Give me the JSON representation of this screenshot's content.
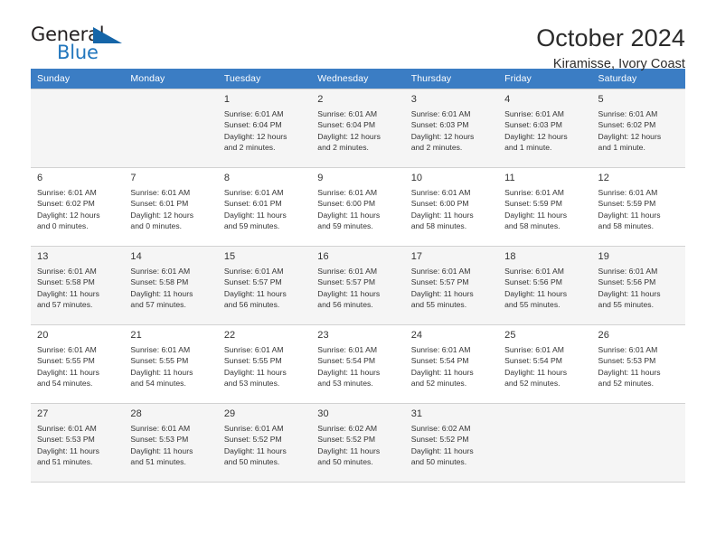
{
  "brand": {
    "word_one": "General",
    "word_two": "Blue",
    "triangle_icon": "triangle-icon",
    "accent_color": "#2176bd",
    "dark_color": "#231f20"
  },
  "header": {
    "title": "October 2024",
    "subtitle": "Kiramisse, Ivory Coast"
  },
  "calendar": {
    "header_bg": "#3b7dc4",
    "weekday_headers": [
      "Sunday",
      "Monday",
      "Tuesday",
      "Wednesday",
      "Thursday",
      "Friday",
      "Saturday"
    ],
    "weeks": [
      [
        {
          "day": "",
          "sunrise": "",
          "sunset": "",
          "daylight_line1": "",
          "daylight_line2": "",
          "empty": true
        },
        {
          "day": "",
          "sunrise": "",
          "sunset": "",
          "daylight_line1": "",
          "daylight_line2": "",
          "empty": true
        },
        {
          "day": "1",
          "sunrise": "Sunrise: 6:01 AM",
          "sunset": "Sunset: 6:04 PM",
          "daylight_line1": "Daylight: 12 hours",
          "daylight_line2": "and 2 minutes.",
          "empty": false
        },
        {
          "day": "2",
          "sunrise": "Sunrise: 6:01 AM",
          "sunset": "Sunset: 6:04 PM",
          "daylight_line1": "Daylight: 12 hours",
          "daylight_line2": "and 2 minutes.",
          "empty": false
        },
        {
          "day": "3",
          "sunrise": "Sunrise: 6:01 AM",
          "sunset": "Sunset: 6:03 PM",
          "daylight_line1": "Daylight: 12 hours",
          "daylight_line2": "and 2 minutes.",
          "empty": false
        },
        {
          "day": "4",
          "sunrise": "Sunrise: 6:01 AM",
          "sunset": "Sunset: 6:03 PM",
          "daylight_line1": "Daylight: 12 hours",
          "daylight_line2": "and 1 minute.",
          "empty": false
        },
        {
          "day": "5",
          "sunrise": "Sunrise: 6:01 AM",
          "sunset": "Sunset: 6:02 PM",
          "daylight_line1": "Daylight: 12 hours",
          "daylight_line2": "and 1 minute.",
          "empty": false
        }
      ],
      [
        {
          "day": "6",
          "sunrise": "Sunrise: 6:01 AM",
          "sunset": "Sunset: 6:02 PM",
          "daylight_line1": "Daylight: 12 hours",
          "daylight_line2": "and 0 minutes.",
          "empty": false
        },
        {
          "day": "7",
          "sunrise": "Sunrise: 6:01 AM",
          "sunset": "Sunset: 6:01 PM",
          "daylight_line1": "Daylight: 12 hours",
          "daylight_line2": "and 0 minutes.",
          "empty": false
        },
        {
          "day": "8",
          "sunrise": "Sunrise: 6:01 AM",
          "sunset": "Sunset: 6:01 PM",
          "daylight_line1": "Daylight: 11 hours",
          "daylight_line2": "and 59 minutes.",
          "empty": false
        },
        {
          "day": "9",
          "sunrise": "Sunrise: 6:01 AM",
          "sunset": "Sunset: 6:00 PM",
          "daylight_line1": "Daylight: 11 hours",
          "daylight_line2": "and 59 minutes.",
          "empty": false
        },
        {
          "day": "10",
          "sunrise": "Sunrise: 6:01 AM",
          "sunset": "Sunset: 6:00 PM",
          "daylight_line1": "Daylight: 11 hours",
          "daylight_line2": "and 58 minutes.",
          "empty": false
        },
        {
          "day": "11",
          "sunrise": "Sunrise: 6:01 AM",
          "sunset": "Sunset: 5:59 PM",
          "daylight_line1": "Daylight: 11 hours",
          "daylight_line2": "and 58 minutes.",
          "empty": false
        },
        {
          "day": "12",
          "sunrise": "Sunrise: 6:01 AM",
          "sunset": "Sunset: 5:59 PM",
          "daylight_line1": "Daylight: 11 hours",
          "daylight_line2": "and 58 minutes.",
          "empty": false
        }
      ],
      [
        {
          "day": "13",
          "sunrise": "Sunrise: 6:01 AM",
          "sunset": "Sunset: 5:58 PM",
          "daylight_line1": "Daylight: 11 hours",
          "daylight_line2": "and 57 minutes.",
          "empty": false
        },
        {
          "day": "14",
          "sunrise": "Sunrise: 6:01 AM",
          "sunset": "Sunset: 5:58 PM",
          "daylight_line1": "Daylight: 11 hours",
          "daylight_line2": "and 57 minutes.",
          "empty": false
        },
        {
          "day": "15",
          "sunrise": "Sunrise: 6:01 AM",
          "sunset": "Sunset: 5:57 PM",
          "daylight_line1": "Daylight: 11 hours",
          "daylight_line2": "and 56 minutes.",
          "empty": false
        },
        {
          "day": "16",
          "sunrise": "Sunrise: 6:01 AM",
          "sunset": "Sunset: 5:57 PM",
          "daylight_line1": "Daylight: 11 hours",
          "daylight_line2": "and 56 minutes.",
          "empty": false
        },
        {
          "day": "17",
          "sunrise": "Sunrise: 6:01 AM",
          "sunset": "Sunset: 5:57 PM",
          "daylight_line1": "Daylight: 11 hours",
          "daylight_line2": "and 55 minutes.",
          "empty": false
        },
        {
          "day": "18",
          "sunrise": "Sunrise: 6:01 AM",
          "sunset": "Sunset: 5:56 PM",
          "daylight_line1": "Daylight: 11 hours",
          "daylight_line2": "and 55 minutes.",
          "empty": false
        },
        {
          "day": "19",
          "sunrise": "Sunrise: 6:01 AM",
          "sunset": "Sunset: 5:56 PM",
          "daylight_line1": "Daylight: 11 hours",
          "daylight_line2": "and 55 minutes.",
          "empty": false
        }
      ],
      [
        {
          "day": "20",
          "sunrise": "Sunrise: 6:01 AM",
          "sunset": "Sunset: 5:55 PM",
          "daylight_line1": "Daylight: 11 hours",
          "daylight_line2": "and 54 minutes.",
          "empty": false
        },
        {
          "day": "21",
          "sunrise": "Sunrise: 6:01 AM",
          "sunset": "Sunset: 5:55 PM",
          "daylight_line1": "Daylight: 11 hours",
          "daylight_line2": "and 54 minutes.",
          "empty": false
        },
        {
          "day": "22",
          "sunrise": "Sunrise: 6:01 AM",
          "sunset": "Sunset: 5:55 PM",
          "daylight_line1": "Daylight: 11 hours",
          "daylight_line2": "and 53 minutes.",
          "empty": false
        },
        {
          "day": "23",
          "sunrise": "Sunrise: 6:01 AM",
          "sunset": "Sunset: 5:54 PM",
          "daylight_line1": "Daylight: 11 hours",
          "daylight_line2": "and 53 minutes.",
          "empty": false
        },
        {
          "day": "24",
          "sunrise": "Sunrise: 6:01 AM",
          "sunset": "Sunset: 5:54 PM",
          "daylight_line1": "Daylight: 11 hours",
          "daylight_line2": "and 52 minutes.",
          "empty": false
        },
        {
          "day": "25",
          "sunrise": "Sunrise: 6:01 AM",
          "sunset": "Sunset: 5:54 PM",
          "daylight_line1": "Daylight: 11 hours",
          "daylight_line2": "and 52 minutes.",
          "empty": false
        },
        {
          "day": "26",
          "sunrise": "Sunrise: 6:01 AM",
          "sunset": "Sunset: 5:53 PM",
          "daylight_line1": "Daylight: 11 hours",
          "daylight_line2": "and 52 minutes.",
          "empty": false
        }
      ],
      [
        {
          "day": "27",
          "sunrise": "Sunrise: 6:01 AM",
          "sunset": "Sunset: 5:53 PM",
          "daylight_line1": "Daylight: 11 hours",
          "daylight_line2": "and 51 minutes.",
          "empty": false
        },
        {
          "day": "28",
          "sunrise": "Sunrise: 6:01 AM",
          "sunset": "Sunset: 5:53 PM",
          "daylight_line1": "Daylight: 11 hours",
          "daylight_line2": "and 51 minutes.",
          "empty": false
        },
        {
          "day": "29",
          "sunrise": "Sunrise: 6:01 AM",
          "sunset": "Sunset: 5:52 PM",
          "daylight_line1": "Daylight: 11 hours",
          "daylight_line2": "and 50 minutes.",
          "empty": false
        },
        {
          "day": "30",
          "sunrise": "Sunrise: 6:02 AM",
          "sunset": "Sunset: 5:52 PM",
          "daylight_line1": "Daylight: 11 hours",
          "daylight_line2": "and 50 minutes.",
          "empty": false
        },
        {
          "day": "31",
          "sunrise": "Sunrise: 6:02 AM",
          "sunset": "Sunset: 5:52 PM",
          "daylight_line1": "Daylight: 11 hours",
          "daylight_line2": "and 50 minutes.",
          "empty": false
        },
        {
          "day": "",
          "sunrise": "",
          "sunset": "",
          "daylight_line1": "",
          "daylight_line2": "",
          "empty": true
        },
        {
          "day": "",
          "sunrise": "",
          "sunset": "",
          "daylight_line1": "",
          "daylight_line2": "",
          "empty": true
        }
      ]
    ]
  }
}
